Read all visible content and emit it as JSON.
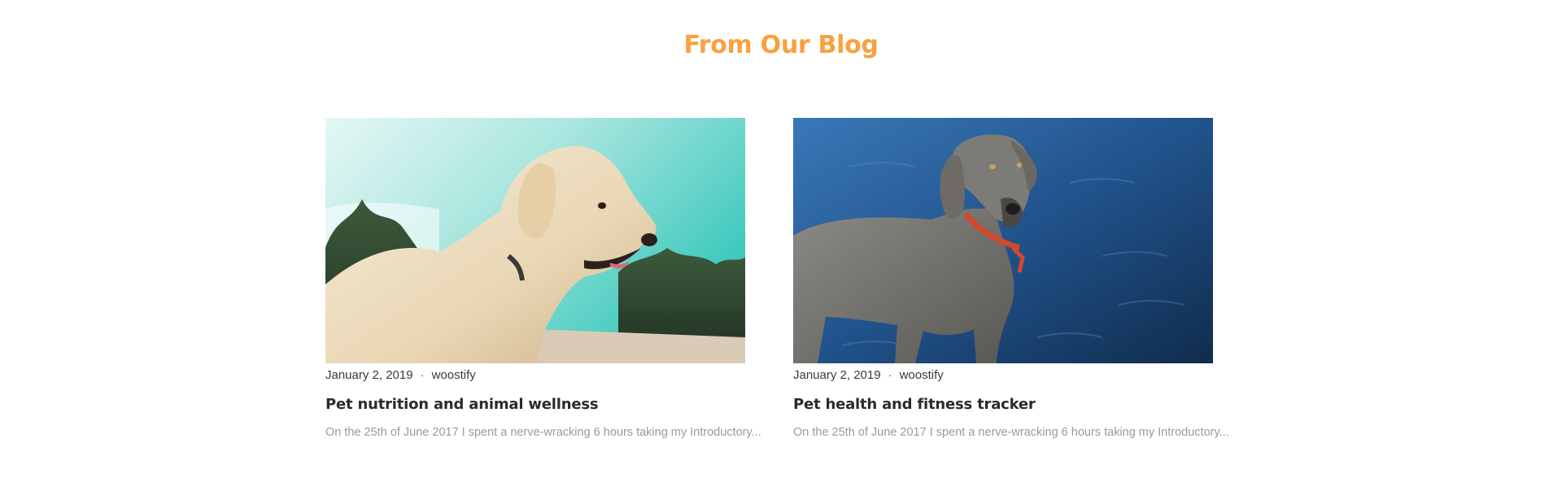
{
  "blog": {
    "title": "From Our Blog",
    "posts": [
      {
        "image_icon": "golden-retriever-photo",
        "date": "January 2, 2019",
        "separator": "·",
        "author": "woostify",
        "title": "Pet nutrition and animal wellness",
        "excerpt": "On the 25th of June 2017 I spent a nerve-wracking 6 hours taking my Introductory..."
      },
      {
        "image_icon": "weimaraner-photo",
        "date": "January 2, 2019",
        "separator": "·",
        "author": "woostify",
        "title": "Pet health and fitness tracker",
        "excerpt": "On the 25th of June 2017 I spent a nerve-wracking 6 hours taking my Introductory..."
      }
    ]
  },
  "colors": {
    "accent": "#f9a03f",
    "heading": "#2b2b2b",
    "excerpt": "#9a9a9a"
  }
}
